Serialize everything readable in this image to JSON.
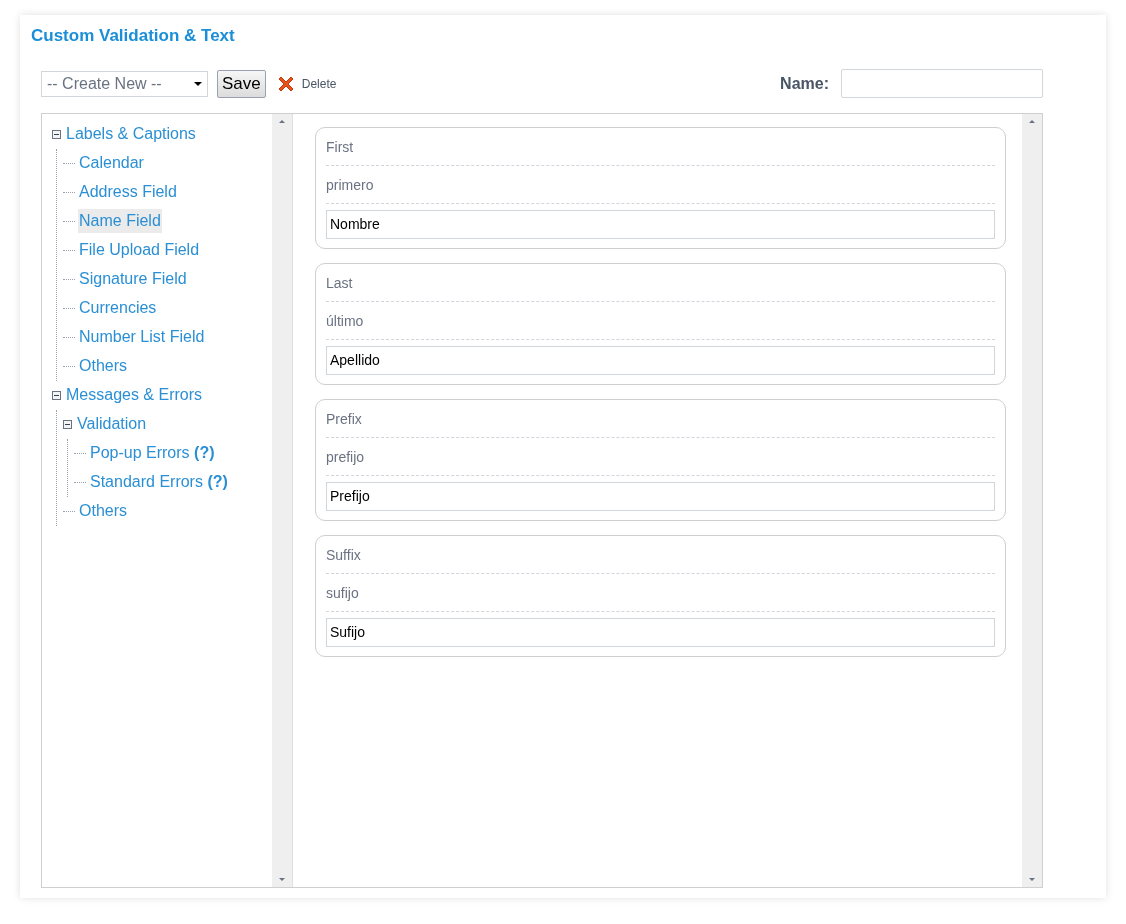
{
  "title": "Custom Validation & Text",
  "toolbar": {
    "create_select": {
      "placeholder": "-- Create New --"
    },
    "save_button": "Save",
    "delete_button": "Delete",
    "name_label": "Name:"
  },
  "tree": [
    {
      "label": "Labels & Captions",
      "expanded": true,
      "selected": false,
      "children": [
        {
          "label": "Calendar",
          "selected": false
        },
        {
          "label": "Address Field",
          "selected": false
        },
        {
          "label": "Name Field",
          "selected": true
        },
        {
          "label": "File Upload Field",
          "selected": false
        },
        {
          "label": "Signature Field",
          "selected": false
        },
        {
          "label": "Currencies",
          "selected": false
        },
        {
          "label": "Number List Field",
          "selected": false
        },
        {
          "label": "Others",
          "selected": false
        }
      ]
    },
    {
      "label": "Messages & Errors",
      "expanded": true,
      "selected": false,
      "children": [
        {
          "label": "Validation",
          "expanded": true,
          "selected": false,
          "children": [
            {
              "label": "Pop-up Errors **(?)**",
              "selected": false
            },
            {
              "label": "Standard Errors **(?)**",
              "selected": false
            }
          ]
        },
        {
          "label": "Others",
          "selected": false
        }
      ]
    }
  ],
  "entries": [
    {
      "key": "First",
      "default": "primero",
      "value": "Nombre"
    },
    {
      "key": "Last",
      "default": "último",
      "value": "Apellido"
    },
    {
      "key": "Prefix",
      "default": "prefijo",
      "value": "Prefijo"
    },
    {
      "key": "Suffix",
      "default": "sufijo",
      "value": "Sufijo"
    }
  ]
}
